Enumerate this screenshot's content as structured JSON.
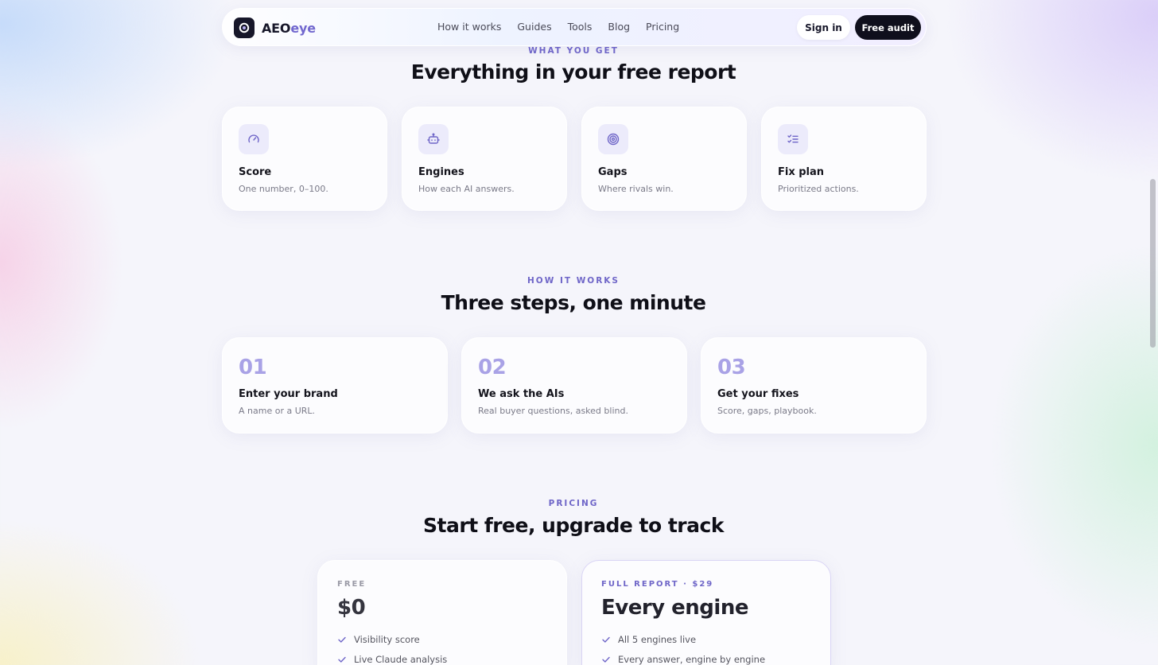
{
  "nav": {
    "brand_prefix": "AEO",
    "brand_suffix": "eye",
    "links": [
      "How it works",
      "Guides",
      "Tools",
      "Blog",
      "Pricing"
    ],
    "sign_in": "Sign in",
    "cta": "Free audit"
  },
  "features": {
    "eyebrow": "WHAT YOU GET",
    "heading": "Everything in your free report",
    "items": [
      {
        "icon": "gauge-icon",
        "title": "Score",
        "desc": "One number, 0–100."
      },
      {
        "icon": "bot-icon",
        "title": "Engines",
        "desc": "How each AI answers."
      },
      {
        "icon": "target-icon",
        "title": "Gaps",
        "desc": "Where rivals win."
      },
      {
        "icon": "checklist-icon",
        "title": "Fix plan",
        "desc": "Prioritized actions."
      }
    ]
  },
  "steps": {
    "eyebrow": "HOW IT WORKS",
    "heading": "Three steps, one minute",
    "items": [
      {
        "num": "01",
        "title": "Enter your brand",
        "desc": "A name or a URL."
      },
      {
        "num": "02",
        "title": "We ask the AIs",
        "desc": "Real buyer questions, asked blind."
      },
      {
        "num": "03",
        "title": "Get your fixes",
        "desc": "Score, gaps, playbook."
      }
    ]
  },
  "pricing": {
    "eyebrow": "PRICING",
    "heading": "Start free, upgrade to track",
    "plans": [
      {
        "label": "FREE",
        "price": "$0",
        "features": [
          "Visibility score",
          "Live Claude analysis"
        ]
      },
      {
        "label": "FULL REPORT · $29",
        "price": "Every engine",
        "features": [
          "All 5 engines live",
          "Every answer, engine by engine"
        ]
      }
    ]
  },
  "colors": {
    "accent": "#6f66c8",
    "step_number": "#a9a2e6",
    "dark": "#0f0f1c"
  }
}
